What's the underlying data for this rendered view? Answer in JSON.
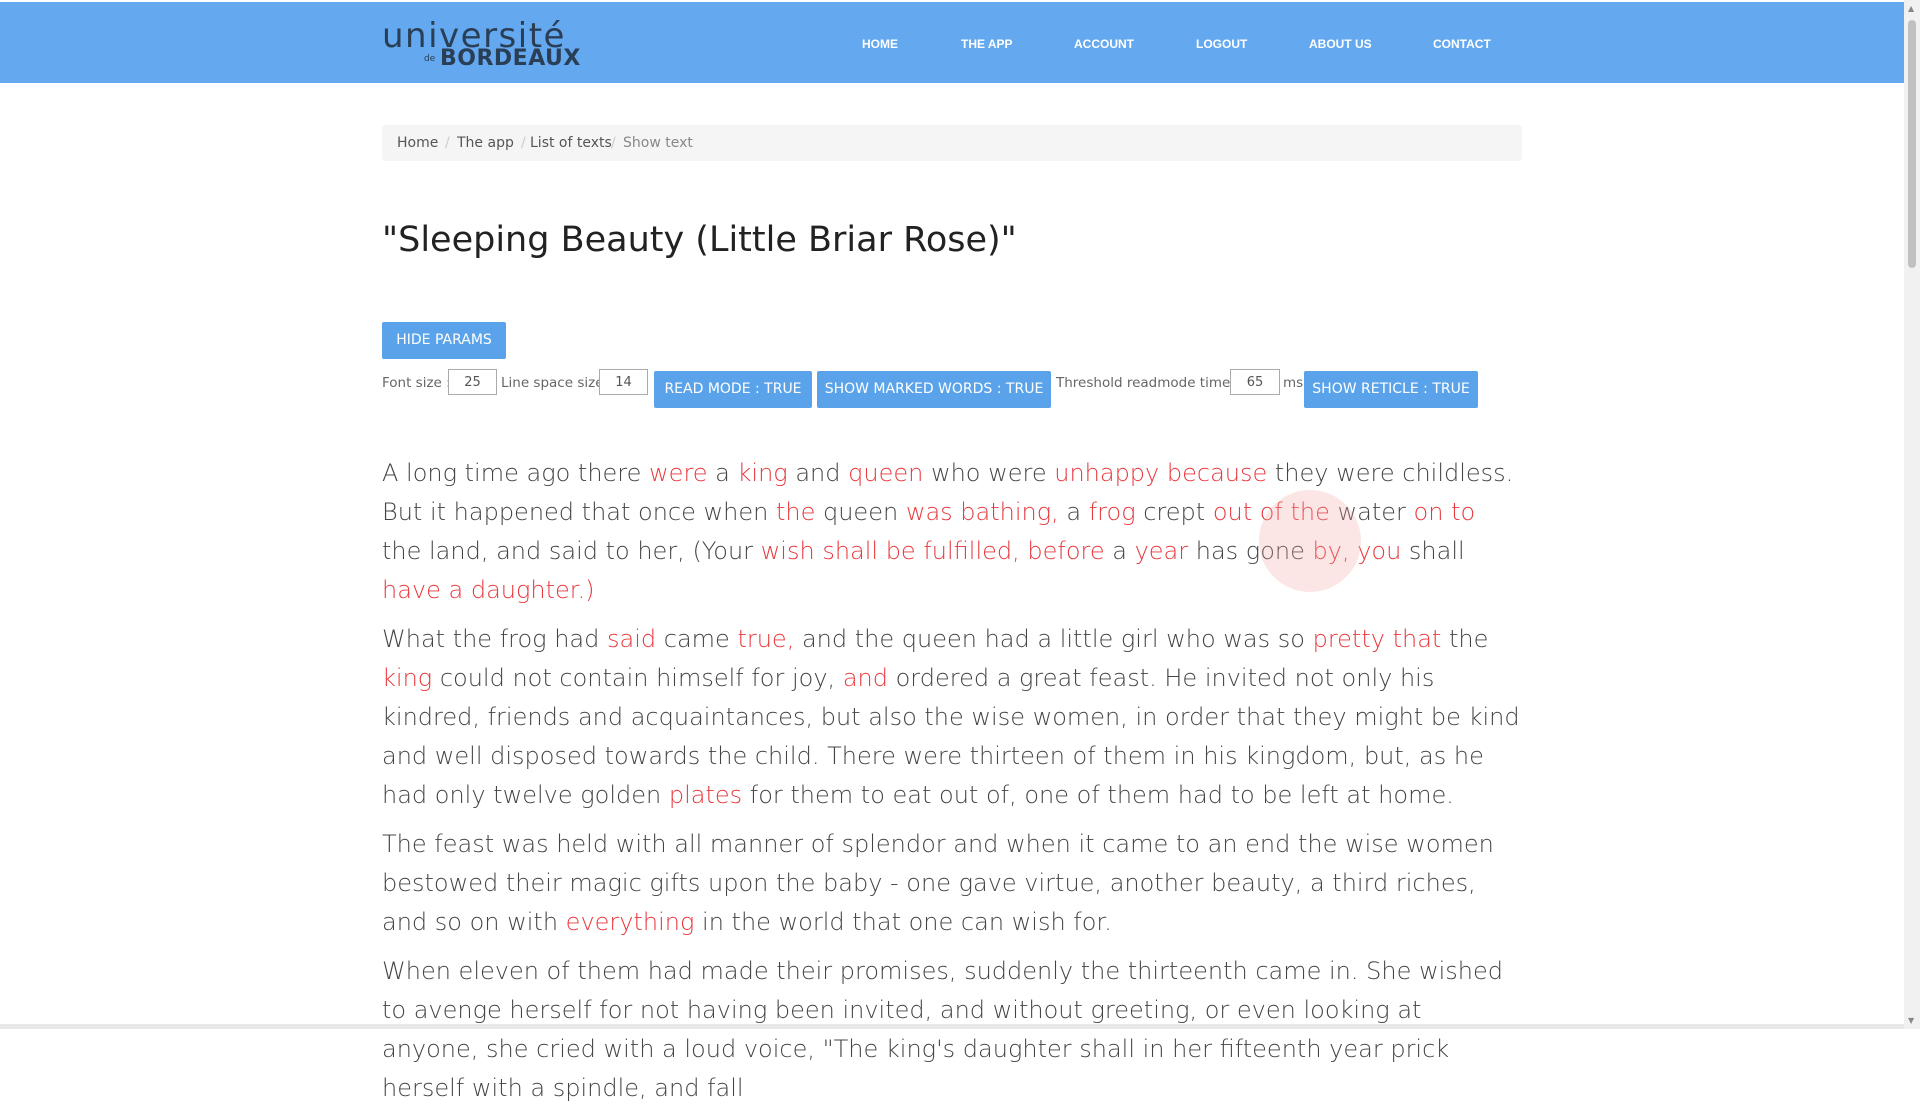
{
  "logo": {
    "top": "université",
    "de": "de",
    "bottom": "BORDEAUX"
  },
  "nav": {
    "home": "HOME",
    "the_app": "THE APP",
    "account": "ACCOUNT",
    "logout": "LOGOUT",
    "about_us": "ABOUT US",
    "contact": "CONTACT"
  },
  "breadcrumb": [
    "Home",
    "The app",
    "List of texts",
    "Show text"
  ],
  "breadcrumb_separator": "/",
  "title": "\"Sleeping Beauty (Little Briar Rose)\"",
  "params": {
    "hide_params": "HIDE PARAMS",
    "font_size_label": "Font size :",
    "font_size_value": "25",
    "line_space_label": "Line space size",
    "line_space_value": "14",
    "read_mode": "READ MODE : TRUE",
    "show_marked_words": "SHOW MARKED WORDS : TRUE",
    "threshold_label": "Threshold readmode time :",
    "threshold_value": "65",
    "threshold_unit": "ms",
    "show_reticle": "SHOW RETICLE : TRUE"
  },
  "colors": {
    "navbar": "#64a8f0",
    "button": "#5aa3ea",
    "marked_word": "#e8383d"
  },
  "paragraphs": [
    [
      [
        "A long time ago there ",
        false
      ],
      [
        "were",
        true
      ],
      [
        " a ",
        false
      ],
      [
        "king",
        true
      ],
      [
        " and ",
        false
      ],
      [
        "queen",
        true
      ],
      [
        " who were ",
        false
      ],
      [
        "unhappy because",
        true
      ],
      [
        " they were childless. But it happened that once when ",
        false
      ],
      [
        "the",
        true
      ],
      [
        " queen ",
        false
      ],
      [
        "was bathing,",
        true
      ],
      [
        " a ",
        false
      ],
      [
        "frog",
        true
      ],
      [
        " crept ",
        false
      ],
      [
        "out of the",
        true
      ],
      [
        " water ",
        false
      ],
      [
        "on to",
        true
      ],
      [
        " the land, and said to her, (Your ",
        false
      ],
      [
        "wish shall be fulfilled, before",
        true
      ],
      [
        " a ",
        false
      ],
      [
        "year",
        true
      ],
      [
        " has gone ",
        false
      ],
      [
        "by, you",
        true
      ],
      [
        " shall ",
        false
      ],
      [
        "have a daughter.)",
        true
      ]
    ],
    [
      [
        "What the frog had ",
        false
      ],
      [
        "said",
        true
      ],
      [
        " came ",
        false
      ],
      [
        "true,",
        true
      ],
      [
        " and the queen had a little girl who was so ",
        false
      ],
      [
        "pretty that",
        true
      ],
      [
        " the ",
        false
      ],
      [
        "king",
        true
      ],
      [
        " could not contain himself for joy, ",
        false
      ],
      [
        "and",
        true
      ],
      [
        " ordered a great feast. He invited not only his kindred, friends and acquaintances, but also the wise women, in order that they might be kind and well disposed towards the child. There were thirteen of them in his kingdom, but, as he had only twelve golden ",
        false
      ],
      [
        "plates",
        true
      ],
      [
        " for them to eat out of, one of them had to be left at home.",
        false
      ]
    ],
    [
      [
        "The feast was held with all manner of splendor and when it came to an end the wise women bestowed their magic gifts upon the baby - one gave virtue, another beauty, a third riches, and so on with ",
        false
      ],
      [
        "everything",
        true
      ],
      [
        " in the world that one can wish for.",
        false
      ]
    ],
    [
      [
        "When eleven of them had made their promises, suddenly the thirteenth came in. She wished to avenge herself for not having been invited, and without greeting, or even looking at anyone, she cried with a loud voice, \"The king's daughter shall in her fifteenth year prick herself with a spindle, and fall",
        false
      ]
    ]
  ]
}
